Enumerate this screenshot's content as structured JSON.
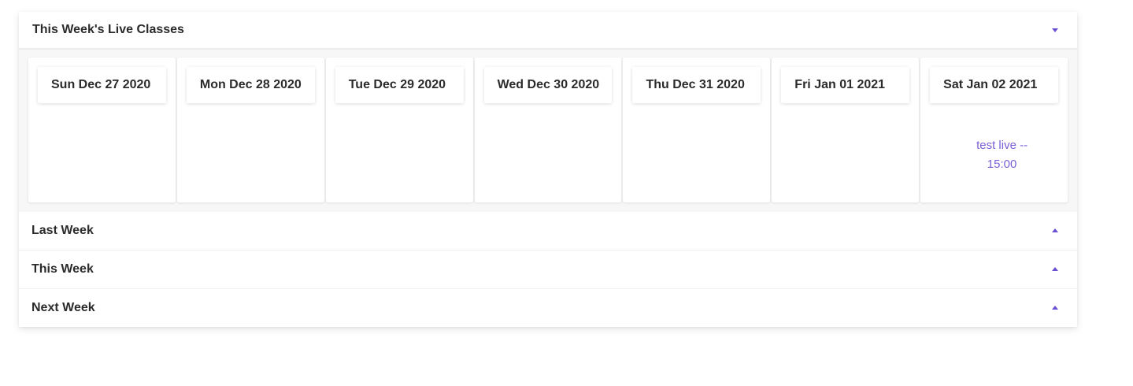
{
  "live_classes": {
    "title": "This Week's Live Classes",
    "days": [
      {
        "label": "Sun Dec 27 2020",
        "events": []
      },
      {
        "label": "Mon Dec 28 2020",
        "events": []
      },
      {
        "label": "Tue Dec 29 2020",
        "events": []
      },
      {
        "label": "Wed Dec 30 2020",
        "events": []
      },
      {
        "label": "Thu Dec 31 2020",
        "events": []
      },
      {
        "label": "Fri Jan 01 2021",
        "events": []
      },
      {
        "label": "Sat Jan 02 2021",
        "events": [
          "test live -- 15:00"
        ]
      }
    ]
  },
  "sections": [
    {
      "title": "Last Week"
    },
    {
      "title": "This Week"
    },
    {
      "title": "Next Week"
    }
  ],
  "icons": {
    "expanded": "chevron-down-icon",
    "collapsed": "chevron-up-icon"
  },
  "colors": {
    "accent": "#6a4fd3",
    "event_text": "#7a5fd6"
  }
}
